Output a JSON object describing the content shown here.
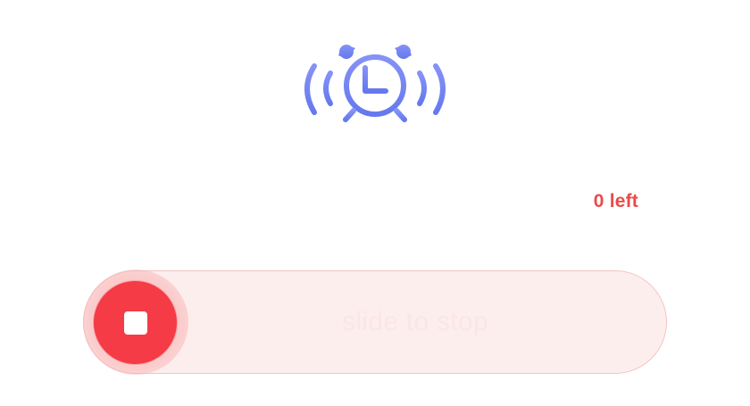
{
  "alarm": {
    "icon": "ringing-alarm-clock-icon",
    "icon_color": "#6f82f2"
  },
  "status": {
    "remaining_text": "0 left",
    "color": "#ea4a4a"
  },
  "slider": {
    "label": "slide to stop",
    "thumb_icon": "stop-icon",
    "progress": 0,
    "accent_color": "#f43b46",
    "track_color": "#fdeeee"
  }
}
